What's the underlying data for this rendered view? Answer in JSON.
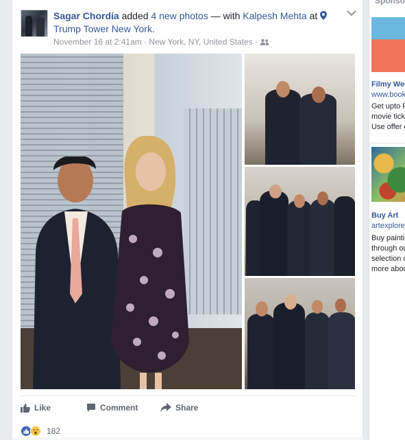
{
  "post": {
    "author": "Sagar Chordia",
    "action_text": " added ",
    "photo_count_text": "4 new photos",
    "with_text": " — with ",
    "tagged_person": "Kalpesh Mehta",
    "at_text": " at ",
    "location": "Trump Tower New York.",
    "timestamp": "November 16 at 2:41am",
    "place": "New York, NY, United States",
    "separator": " · "
  },
  "actions": {
    "like_label": "Like",
    "comment_label": "Comment",
    "share_label": "Share"
  },
  "reactions": {
    "count": "182"
  },
  "sidebar": {
    "sponsored_label": "Sponsore",
    "ads": [
      {
        "title": "Filmy Wee",
        "url": "www.book",
        "body_lines": [
          "Get upto F",
          "movie tick",
          "Use offer c"
        ]
      },
      {
        "title": "Buy Art",
        "url": "artexplore",
        "body_lines": [
          "Buy painti",
          "through ou",
          "selection c",
          "more abou"
        ]
      }
    ]
  },
  "colors": {
    "link": "#365899",
    "meta": "#90949c",
    "like_blue": "#4267b2",
    "wow_yellow": "#f7c94d"
  },
  "icons": [
    "location-pin-icon",
    "friends-audience-icon",
    "chevron-down-icon",
    "like-thumb-icon",
    "comment-icon",
    "share-arrow-icon",
    "like-reaction-icon",
    "wow-reaction-icon"
  ]
}
